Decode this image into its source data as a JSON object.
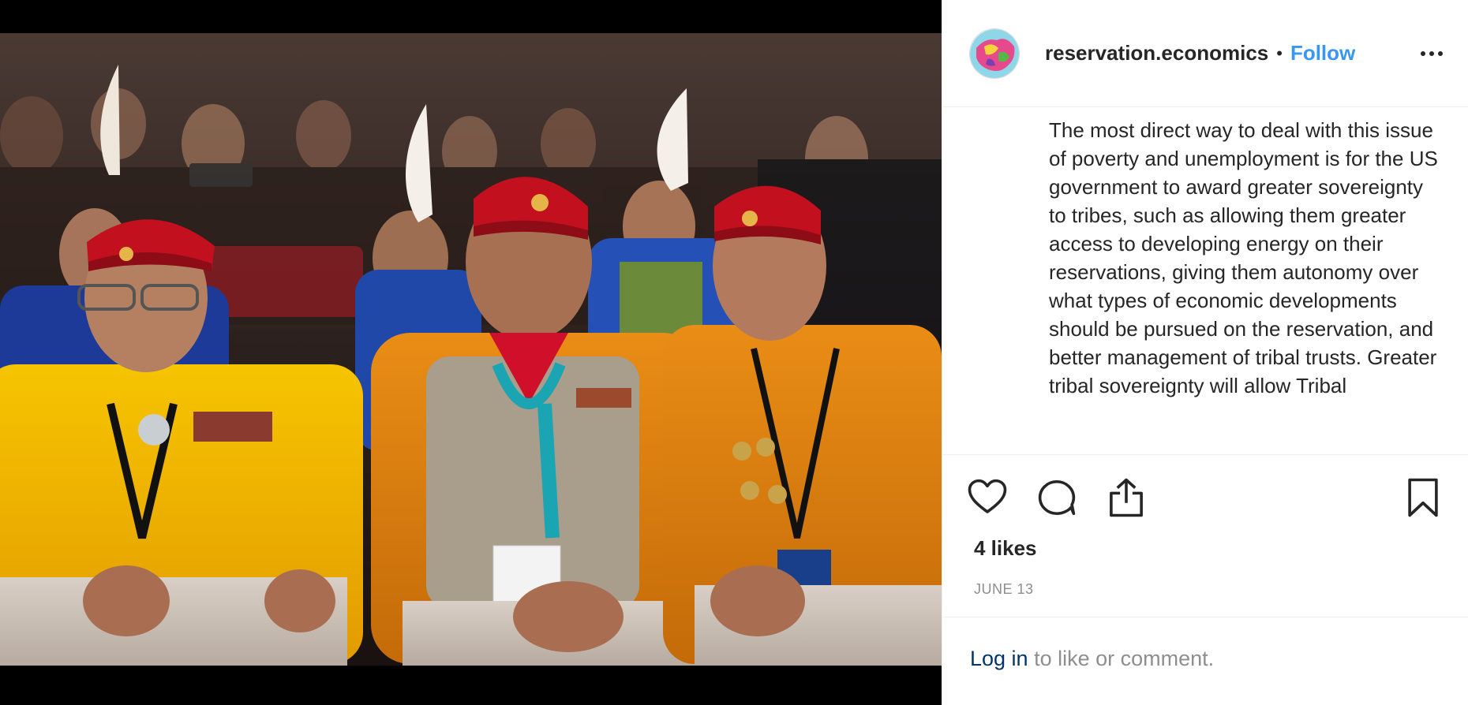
{
  "post": {
    "username": "reservation.economics",
    "separator": "•",
    "follow_label": "Follow",
    "caption": "The most direct way to deal with this issue of poverty and unemployment is for the US government to award greater sovereignty to tribes, such as allowing them greater access to developing energy on their reservations, giving them autonomy over what types of economic developments should be pursued on the reservation, and better management of tribal trusts. Greater tribal sovereignty will allow Tribal",
    "likes": "4 likes",
    "date": "JUNE 13"
  },
  "footer": {
    "login_link": "Log in",
    "login_rest": " to like or comment."
  },
  "icons": {
    "like": "heart-icon",
    "comment": "comment-icon",
    "share": "share-icon",
    "save": "bookmark-icon",
    "more": "more-icon"
  },
  "colors": {
    "link": "#3897f0",
    "text": "#262626",
    "muted": "#8e8e8e",
    "login_link": "#003569"
  }
}
